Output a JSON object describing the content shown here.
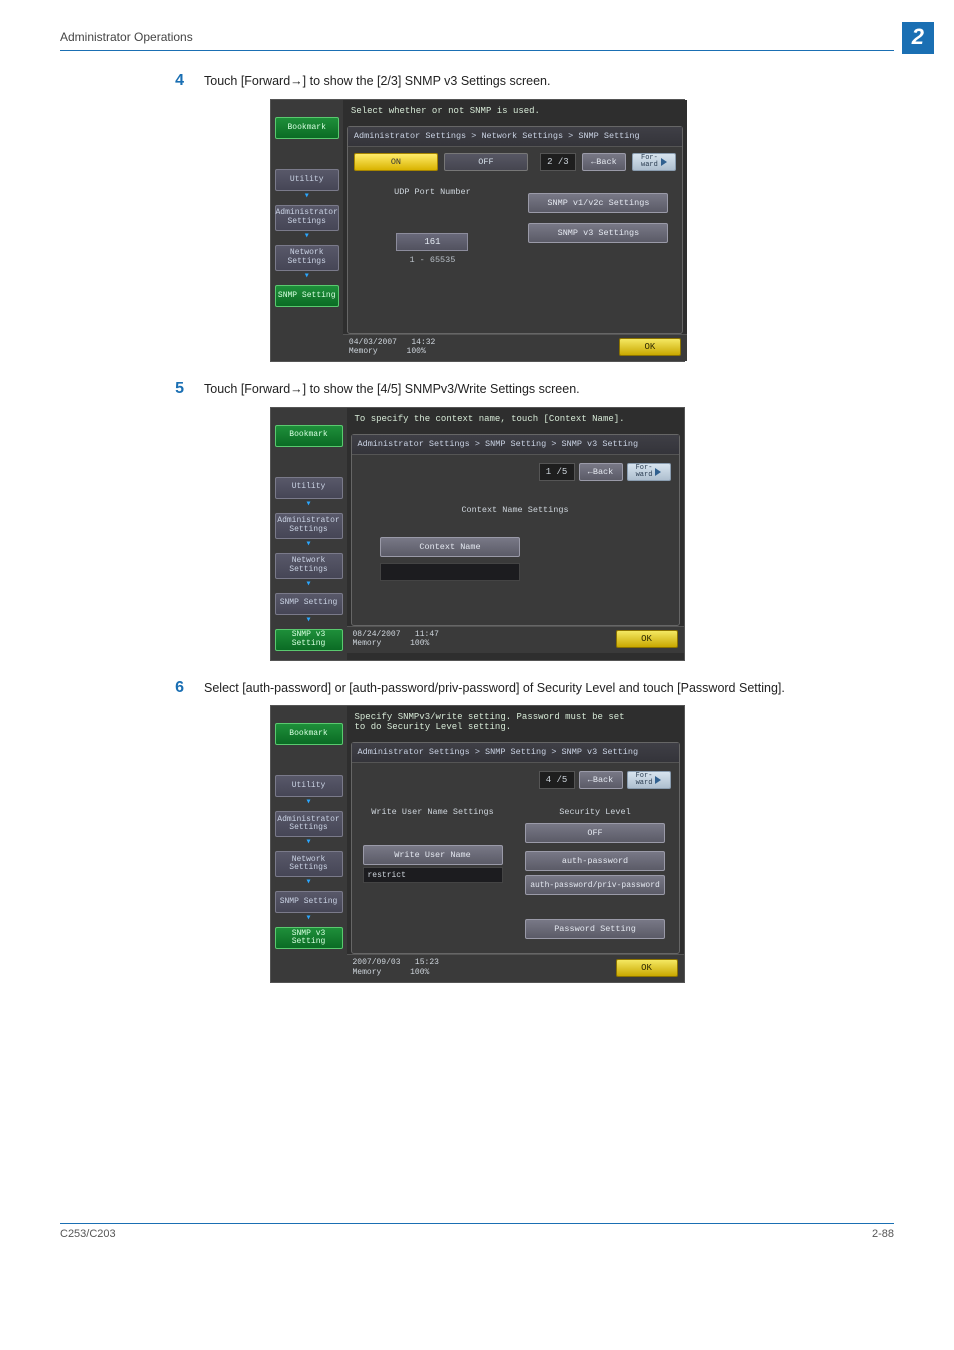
{
  "header": {
    "title": "Administrator Operations",
    "chapter": "2"
  },
  "steps": [
    {
      "num": "4",
      "text_before": "Touch [Forward",
      "text_after": "] to show the [2/3] SNMP v3 Settings screen."
    },
    {
      "num": "5",
      "text_before": "Touch [Forward",
      "text_after": "] to show the [4/5] SNMPv3/Write Settings screen."
    },
    {
      "num": "6",
      "text_full": "Select [auth-password] or [auth-password/priv-password] of Security Level and touch [Password Setting]."
    }
  ],
  "common": {
    "bookmark": "Bookmark",
    "utility": "Utility",
    "admin_settings": "Administrator\nSettings",
    "network_settings": "Network\nSettings",
    "snmp_setting": "SNMP Setting",
    "snmp_v3_setting": "SNMP v3 Setting",
    "ok": "OK",
    "back": "Back",
    "fwd_small": "For-\nward"
  },
  "shot4": {
    "msg": "Select whether or not SNMP is used.",
    "crumb": "Administrator Settings > Network Settings > SNMP Setting",
    "on": "ON",
    "off": "OFF",
    "page": "2 /3",
    "left_label": "UDP Port Number",
    "port_val": "161",
    "range": "1  -  65535",
    "right_btn1": "SNMP v1/v2c Settings",
    "right_btn2": "SNMP v3 Settings",
    "date": "04/03/2007",
    "time": "14:32",
    "mem_lbl": "Memory",
    "mem_val": "100%"
  },
  "shot5": {
    "msg": "To specify the context name, touch [Context Name].",
    "crumb": "Administrator Settings > SNMP Setting > SNMP v3 Setting",
    "page": "1 /5",
    "title": "Context Name Settings",
    "btn": "Context Name",
    "date": "08/24/2007",
    "time": "11:47",
    "mem_lbl": "Memory",
    "mem_val": "100%"
  },
  "shot6": {
    "msg": "Specify SNMPv3/write setting. Password must be set\nto do Security Level setting.",
    "crumb": "Administrator Settings > SNMP Setting > SNMP v3 Setting",
    "page": "4 /5",
    "left_head": "Write User Name Settings",
    "left_btn": "Write User Name",
    "left_val": "restrict",
    "right_head": "Security Level",
    "off": "OFF",
    "auth": "auth-password",
    "authpriv": "auth-password/priv-password",
    "pwd_setting": "Password Setting",
    "date": "2007/09/03",
    "time": "15:23",
    "mem_lbl": "Memory",
    "mem_val": "100%"
  },
  "footer": {
    "model": "C253/C203",
    "page": "2-88"
  }
}
